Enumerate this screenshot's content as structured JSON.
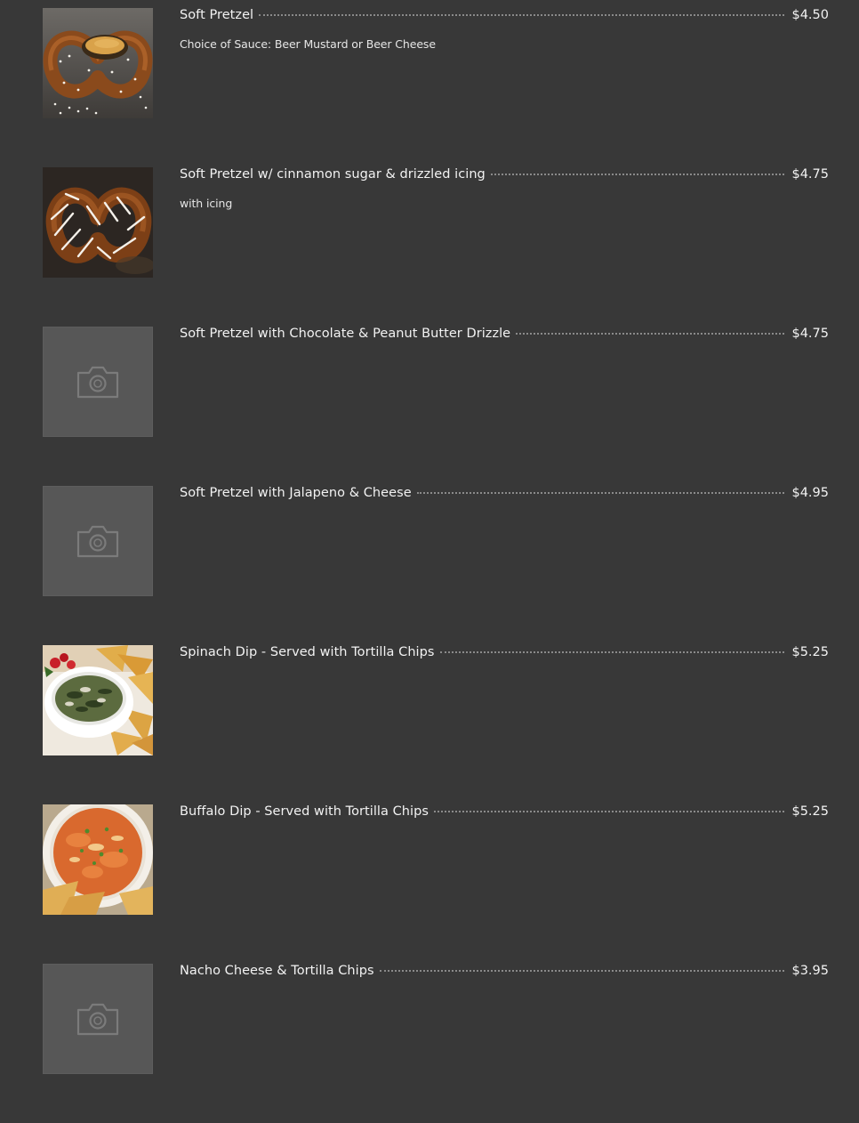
{
  "menu": {
    "items": [
      {
        "title": "Soft Pretzel",
        "price": "$4.50",
        "description": "Choice of Sauce: Beer Mustard or Beer Cheese",
        "image": "soft-pretzel-photo"
      },
      {
        "title": "Soft Pretzel w/ cinnamon sugar & drizzled icing",
        "price": "$4.75",
        "description": "with icing",
        "image": "iced-pretzel-photo"
      },
      {
        "title": "Soft Pretzel with Chocolate & Peanut Butter Drizzle",
        "price": "$4.75",
        "description": "",
        "image": "camera-icon"
      },
      {
        "title": "Soft Pretzel with Jalapeno & Cheese",
        "price": "$4.95",
        "description": "",
        "image": "camera-icon"
      },
      {
        "title": "Spinach Dip - Served with Tortilla Chips",
        "price": "$5.25",
        "description": "",
        "image": "spinach-dip-photo"
      },
      {
        "title": "Buffalo Dip - Served with Tortilla Chips",
        "price": "$5.25",
        "description": "",
        "image": "buffalo-dip-photo"
      },
      {
        "title": "Nacho Cheese & Tortilla Chips",
        "price": "$3.95",
        "description": "",
        "image": "camera-icon"
      }
    ]
  },
  "colors": {
    "background": "#383838",
    "text": "#f2f2f2",
    "placeholder": "#575757",
    "leader_dots": "#8a8a8a"
  }
}
